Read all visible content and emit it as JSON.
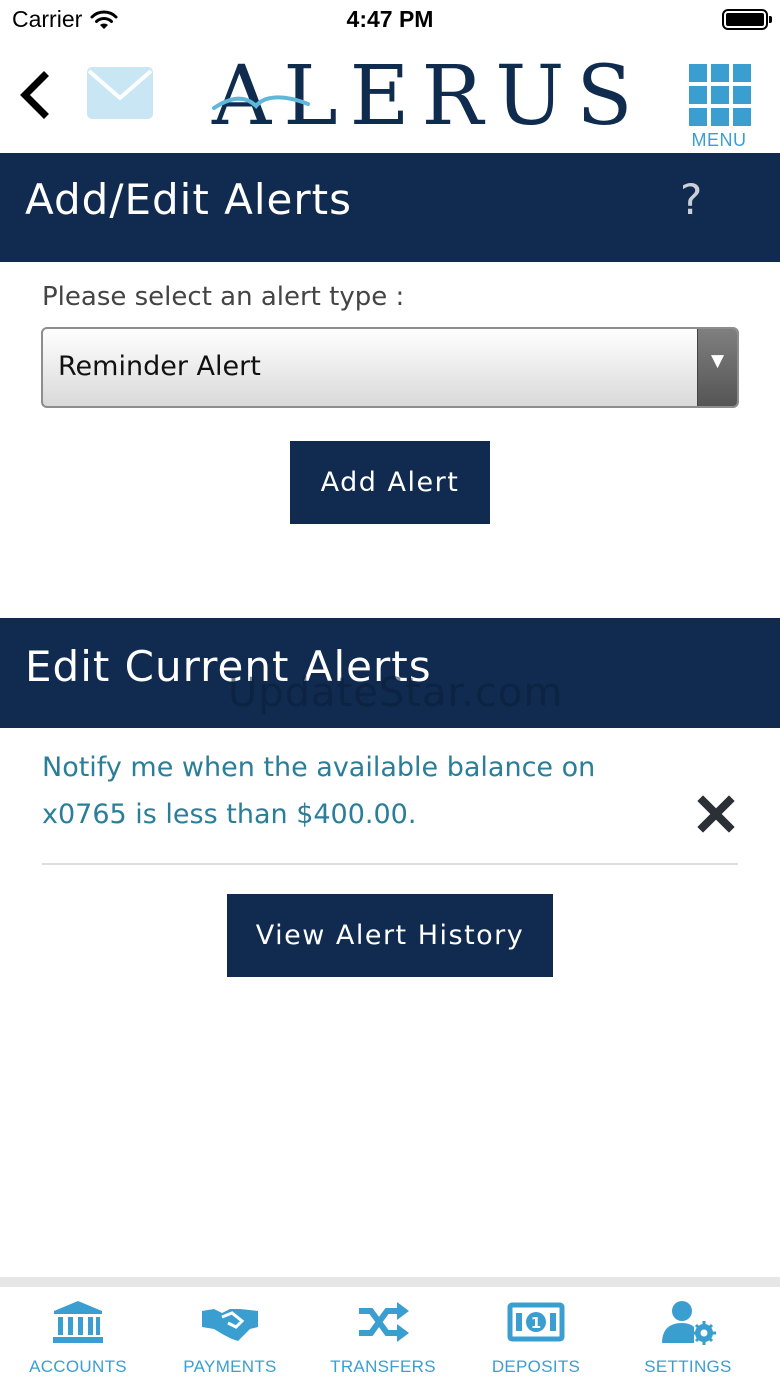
{
  "status_bar": {
    "carrier": "Carrier",
    "time": "4:47 PM"
  },
  "header": {
    "logo_text": "ALERUS",
    "menu_label": "MENU",
    "icons": [
      "back-chevron-icon",
      "mail-envelope-icon",
      "grid-menu-icon"
    ]
  },
  "add_section": {
    "title": "Add/Edit Alerts",
    "help_label": "?",
    "prompt": "Please select an alert type :",
    "selected_alert_type": "Reminder Alert",
    "add_button": "Add Alert"
  },
  "edit_section": {
    "title": "Edit Current Alerts",
    "watermark": "UpdateStar.com",
    "alerts": [
      {
        "line1": "Notify me when the available balance on",
        "line2": "x0765 is less than $400.00."
      }
    ],
    "history_button": "View Alert History"
  },
  "tab_bar": {
    "tabs": [
      {
        "label": "ACCOUNTS",
        "icon": "bank-icon"
      },
      {
        "label": "PAYMENTS",
        "icon": "handshake-icon"
      },
      {
        "label": "TRANSFERS",
        "icon": "shuffle-icon"
      },
      {
        "label": "DEPOSITS",
        "icon": "cash-icon"
      },
      {
        "label": "SETTINGS",
        "icon": "user-gear-icon"
      }
    ]
  },
  "colors": {
    "navy": "#102b4f",
    "accent_blue": "#3a9fd0",
    "alert_text": "#2a7e99"
  }
}
